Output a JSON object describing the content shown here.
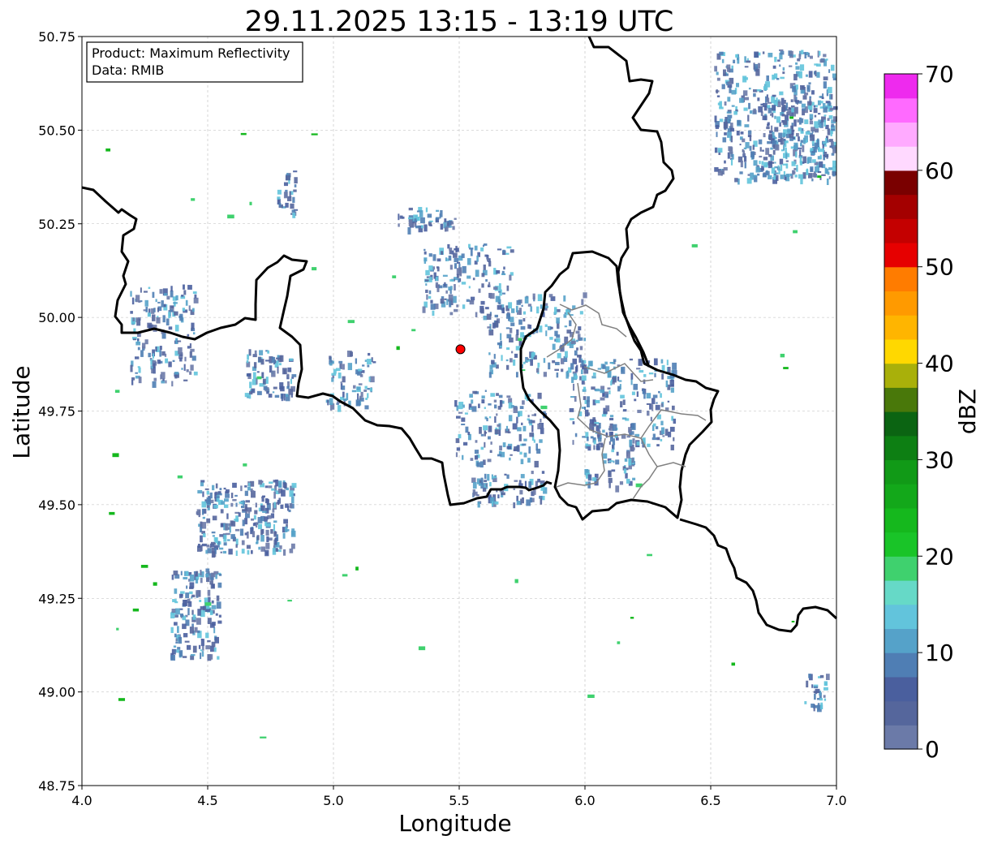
{
  "title": "29.11.2025 13:15 - 13:19 UTC",
  "xlabel": "Longitude",
  "ylabel": "Latitude",
  "info": {
    "product": "Product: Maximum Reflectivity",
    "data": "Data: RMIB"
  },
  "colorbar": {
    "label": "dBZ",
    "min": 0,
    "max": 70,
    "step": 2.5,
    "ticks": [
      "0",
      "10",
      "20",
      "30",
      "40",
      "50",
      "60",
      "70"
    ],
    "colors": [
      "#6b7aa8",
      "#55669c",
      "#4a5f9e",
      "#4f7eb4",
      "#55a2c9",
      "#62c4dc",
      "#66d9c7",
      "#3fd16e",
      "#19c428",
      "#15b81d",
      "#13a81a",
      "#119a17",
      "#0d7f13",
      "#0b6412",
      "#49780a",
      "#a9b00a",
      "#ffd800",
      "#ffb500",
      "#ff9a00",
      "#ff7c00",
      "#e60000",
      "#c40000",
      "#a40000",
      "#7a0000",
      "#ffd9ff",
      "#ffaaff",
      "#ff6aff",
      "#ee2aee"
    ]
  },
  "map": {
    "lon_range": [
      4.0,
      7.0
    ],
    "lat_range": [
      48.75,
      50.75
    ],
    "lon_ticks": [
      "4.0",
      "4.5",
      "5.0",
      "5.5",
      "6.0",
      "6.5",
      "7.0"
    ],
    "lat_ticks": [
      "48.75",
      "49.00",
      "49.25",
      "49.50",
      "49.75",
      "50.00",
      "50.25",
      "50.50",
      "50.75"
    ],
    "grid": true,
    "radar_site": {
      "lon": 5.505,
      "lat": 49.915,
      "color": "#ff0000"
    },
    "borders_color": "#000000",
    "inner_borders_color": "#808080"
  }
}
